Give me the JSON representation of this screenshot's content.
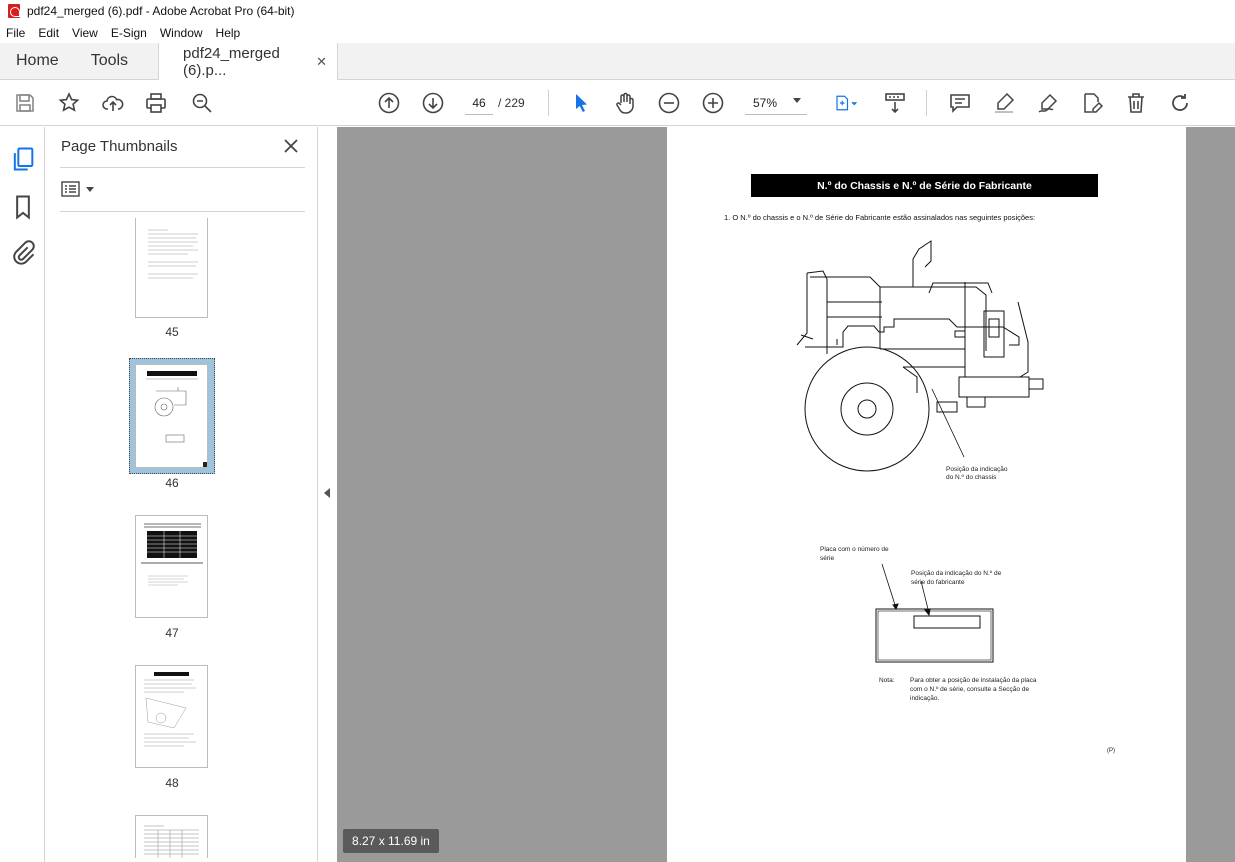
{
  "window": {
    "title": "pdf24_merged (6).pdf - Adobe Acrobat Pro (64-bit)"
  },
  "menu": [
    "File",
    "Edit",
    "View",
    "E-Sign",
    "Window",
    "Help"
  ],
  "tabs": {
    "home": "Home",
    "tools": "Tools",
    "document": "pdf24_merged (6).p..."
  },
  "toolbar": {
    "page_current": "46",
    "page_total": "/ 229",
    "zoom": "57%"
  },
  "icons": [
    "save-icon",
    "bookmark-star-icon",
    "upload-icon",
    "print-icon",
    "find-zoom-icon",
    "prev-page-icon",
    "next-page-icon",
    "select-cursor-icon",
    "hand-icon",
    "zoom-out-icon",
    "zoom-in-icon",
    "fit-page-icon",
    "scroll-mode-icon",
    "comment-icon",
    "highlight-icon",
    "sign-icon",
    "edit-pdf-icon",
    "delete-icon",
    "rotate-icon"
  ],
  "sidebar": {
    "title": "Page Thumbnails",
    "thumbnails": [
      {
        "label": "45"
      },
      {
        "label": "46"
      },
      {
        "label": "47"
      },
      {
        "label": "48"
      },
      {
        "label": ""
      }
    ]
  },
  "page": {
    "heading": "N.º do Chassis e N.º de Série do Fabricante",
    "line1": "1.  O N.º do chassis e o N.º de Série do Fabricante estão assinalados nas seguintes posições:",
    "label_chassis_1": "Posição da indicação",
    "label_chassis_2": "do N.º do chassis",
    "label_plate_1": "Placa com o número de",
    "label_plate_2": "série",
    "label_serial_1": "Posição da indicação do N.º de",
    "label_serial_2": "série do fabricante",
    "note_label": "Nota:",
    "note_1": "Para obter a posição de instalação da placa",
    "note_2": "com o N.º de série, consulte a Secção de",
    "note_3": "indicação.",
    "footer_mark": "(P)"
  },
  "status": {
    "page_size": "8.27 x 11.69 in"
  }
}
